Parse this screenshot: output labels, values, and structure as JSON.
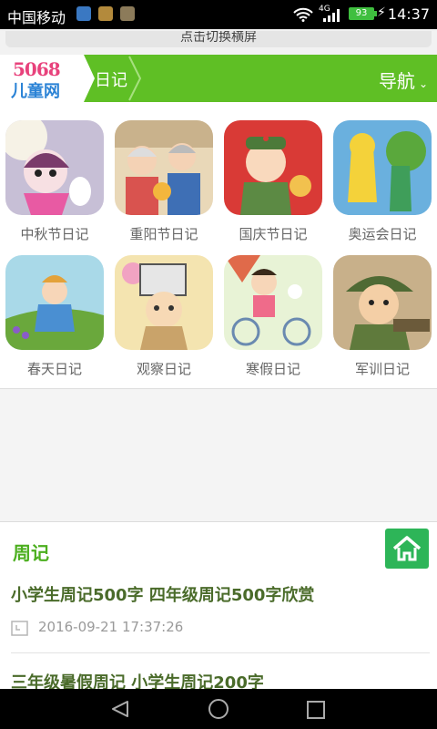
{
  "status_bar": {
    "carrier": "中国移动",
    "network": "4G",
    "battery": "93",
    "time": "14:37"
  },
  "landscape_banner": "点击切换横屏",
  "header": {
    "logo_num": "5068",
    "logo_cn": "儿童网",
    "breadcrumb": "日记",
    "nav_label": "导航",
    "nav_icon": "chevron-down-icon",
    "colors": {
      "header_bg": "#5fbf25",
      "logo_pink": "#e8427c",
      "logo_blue": "#2b83d6"
    }
  },
  "categories": [
    {
      "label": "中秋节日记",
      "icon": "mid-autumn-thumbnail"
    },
    {
      "label": "重阳节日记",
      "icon": "double-ninth-thumbnail"
    },
    {
      "label": "国庆节日记",
      "icon": "national-day-thumbnail"
    },
    {
      "label": "奥运会日记",
      "icon": "olympics-thumbnail"
    },
    {
      "label": "春天日记",
      "icon": "spring-thumbnail"
    },
    {
      "label": "观察日记",
      "icon": "observation-thumbnail"
    },
    {
      "label": "寒假日记",
      "icon": "winter-vacation-thumbnail"
    },
    {
      "label": "军训日记",
      "icon": "military-training-thumbnail"
    }
  ],
  "section": {
    "title": "周记",
    "home_icon": "home-icon",
    "articles": [
      {
        "title": "小学生周记500字 四年级周记500字欣赏",
        "date": "2016-09-21 17:37:26"
      },
      {
        "title": "三年级暑假周记 小学生周记200字"
      }
    ]
  }
}
